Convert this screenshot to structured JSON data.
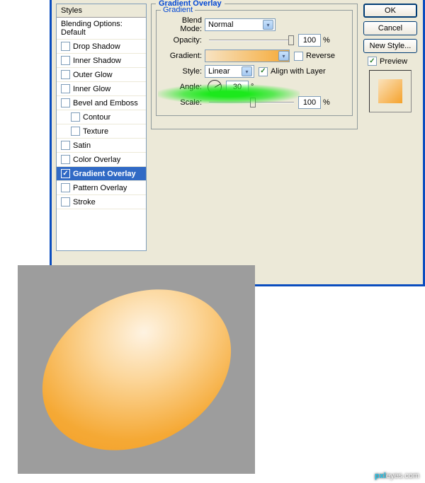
{
  "stylesPanel": {
    "header": "Styles",
    "blendingDefault": "Blending Options: Default",
    "items": [
      {
        "label": "Drop Shadow",
        "checked": false
      },
      {
        "label": "Inner Shadow",
        "checked": false
      },
      {
        "label": "Outer Glow",
        "checked": false
      },
      {
        "label": "Inner Glow",
        "checked": false
      },
      {
        "label": "Bevel and Emboss",
        "checked": false
      },
      {
        "label": "Contour",
        "checked": false,
        "indent": true
      },
      {
        "label": "Texture",
        "checked": false,
        "indent": true
      },
      {
        "label": "Satin",
        "checked": false
      },
      {
        "label": "Color Overlay",
        "checked": false
      },
      {
        "label": "Gradient Overlay",
        "checked": true,
        "selected": true
      },
      {
        "label": "Pattern Overlay",
        "checked": false
      },
      {
        "label": "Stroke",
        "checked": false
      }
    ]
  },
  "settings": {
    "title": "Gradient Overlay",
    "groupTitle": "Gradient",
    "blendMode": {
      "label": "Blend Mode:",
      "value": "Normal"
    },
    "opacity": {
      "label": "Opacity:",
      "value": "100",
      "unit": "%"
    },
    "gradient": {
      "label": "Gradient:"
    },
    "reverse": {
      "label": "Reverse",
      "checked": false
    },
    "style": {
      "label": "Style:",
      "value": "Linear"
    },
    "alignWithLayer": {
      "label": "Align with Layer",
      "checked": true
    },
    "angle": {
      "label": "Angle:",
      "value": "30",
      "unit": "°"
    },
    "scale": {
      "label": "Scale:",
      "value": "100",
      "unit": "%"
    }
  },
  "buttons": {
    "ok": "OK",
    "cancel": "Cancel",
    "newStyle": "New Style..."
  },
  "previewCheck": {
    "label": "Preview",
    "checked": true
  },
  "watermark": {
    "prefix": "pxl",
    "suffix": "eyes.com"
  }
}
